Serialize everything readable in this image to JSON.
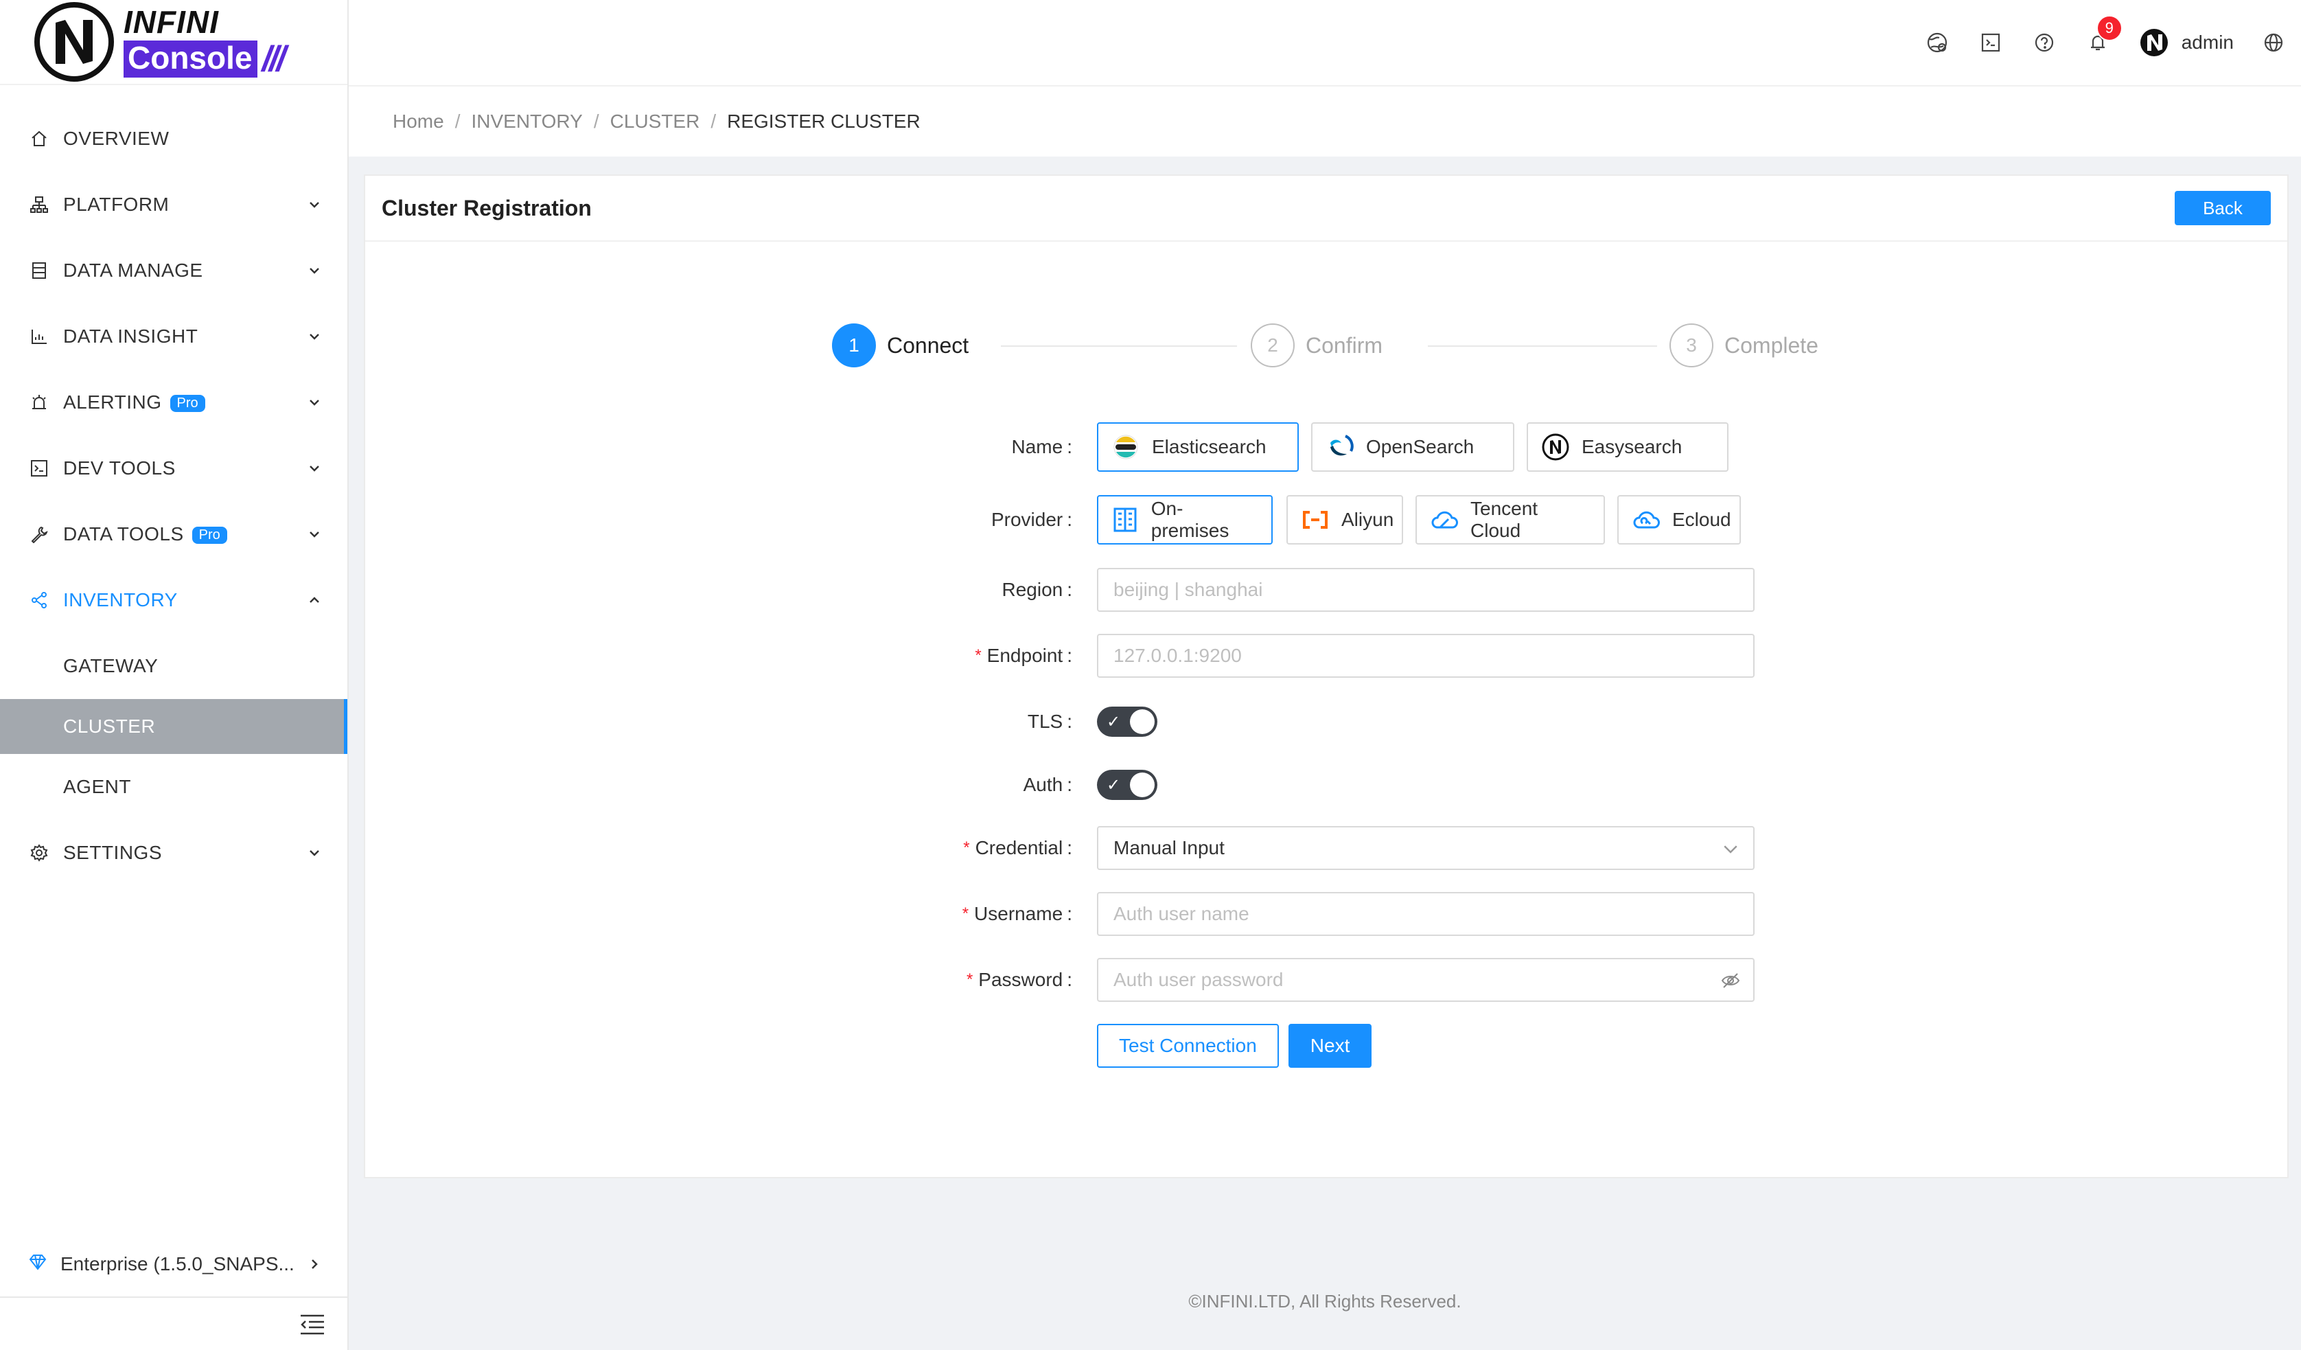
{
  "app": {
    "logo_top": "INFINI",
    "logo_bottom": "Console",
    "logo_slashes": "///"
  },
  "sidebar": {
    "items": [
      {
        "label": "OVERVIEW",
        "icon": "home-icon"
      },
      {
        "label": "PLATFORM",
        "icon": "platform-icon"
      },
      {
        "label": "DATA MANAGE",
        "icon": "database-icon"
      },
      {
        "label": "DATA INSIGHT",
        "icon": "chart-icon"
      },
      {
        "label": "ALERTING",
        "icon": "alarm-icon",
        "badge": "Pro"
      },
      {
        "label": "DEV TOOLS",
        "icon": "terminal-icon"
      },
      {
        "label": "DATA TOOLS",
        "icon": "wrench-icon",
        "badge": "Pro"
      },
      {
        "label": "INVENTORY",
        "icon": "share-icon"
      },
      {
        "label": "GATEWAY"
      },
      {
        "label": "CLUSTER"
      },
      {
        "label": "AGENT"
      },
      {
        "label": "SETTINGS",
        "icon": "gear-icon"
      }
    ],
    "version": "Enterprise (1.5.0_SNAPS..."
  },
  "header": {
    "notification_count": "9",
    "username": "admin"
  },
  "breadcrumb": {
    "home": "Home",
    "inventory": "INVENTORY",
    "cluster": "CLUSTER",
    "current": "REGISTER CLUSTER"
  },
  "card": {
    "title": "Cluster Registration",
    "back_label": "Back"
  },
  "steps": [
    {
      "num": "1",
      "label": "Connect"
    },
    {
      "num": "2",
      "label": "Confirm"
    },
    {
      "num": "3",
      "label": "Complete"
    }
  ],
  "form": {
    "name_label": "Name",
    "name_options": [
      "Elasticsearch",
      "OpenSearch",
      "Easysearch"
    ],
    "provider_label": "Provider",
    "provider_options": [
      "On-premises",
      "Aliyun",
      "Tencent Cloud",
      "Ecloud"
    ],
    "region_label": "Region",
    "region_placeholder": "beijing | shanghai",
    "endpoint_label": "Endpoint",
    "endpoint_placeholder": "127.0.0.1:9200",
    "tls_label": "TLS",
    "auth_label": "Auth",
    "credential_label": "Credential",
    "credential_value": "Manual Input",
    "username_label": "Username",
    "username_placeholder": "Auth user name",
    "password_label": "Password",
    "password_placeholder": "Auth user password",
    "test_connection": "Test Connection",
    "next": "Next"
  },
  "footer": {
    "copyright": "©INFINI.LTD, All Rights Reserved."
  }
}
